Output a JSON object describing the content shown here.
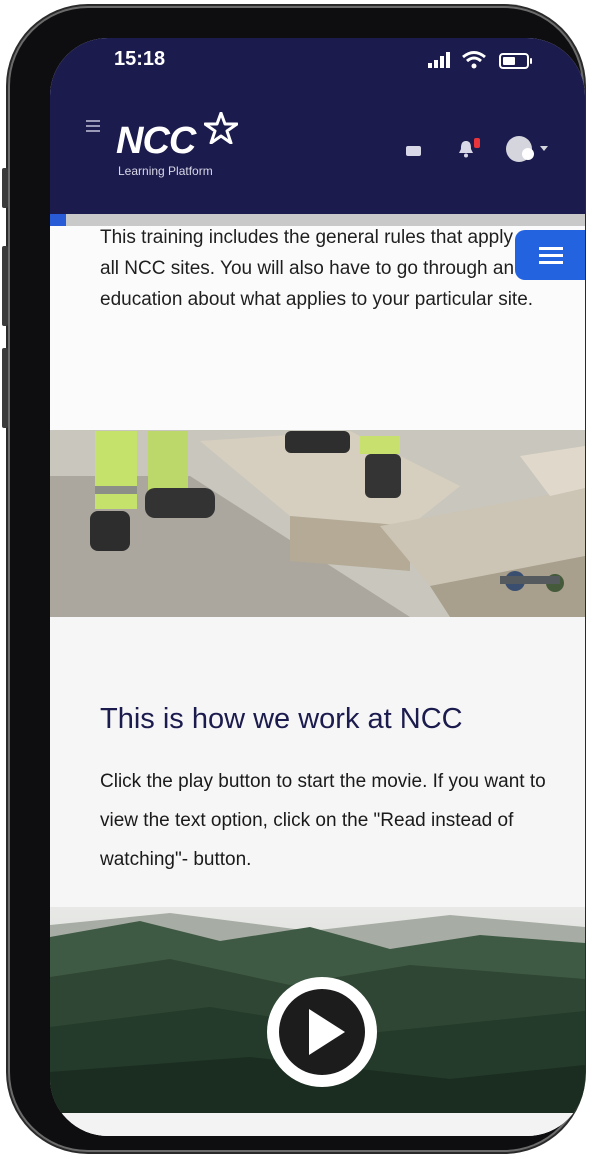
{
  "status_bar": {
    "time": "15:18"
  },
  "header": {
    "logo_text": "NCC",
    "logo_subtitle": "Learning Platform",
    "notification_count": "1"
  },
  "progress": {
    "fraction": 0.03
  },
  "intro": {
    "text": "This training includes the general rules that apply at all NCC sites. You will also have to go through an education about what applies to your particular site."
  },
  "section": {
    "title": "This is how we work at NCC",
    "body": "Click the play button to start the movie. If you want to view the text option, click on the \"Read instead of watching\"- button."
  },
  "colors": {
    "header_bg": "#1b1b4d",
    "accent": "#2463e0",
    "heading": "#1b1b4d",
    "progress_fill": "#2a5bd7"
  },
  "icons": [
    "hamburger-icon",
    "mail-icon",
    "bell-icon",
    "user-avatar",
    "menu-icon",
    "play-icon"
  ]
}
